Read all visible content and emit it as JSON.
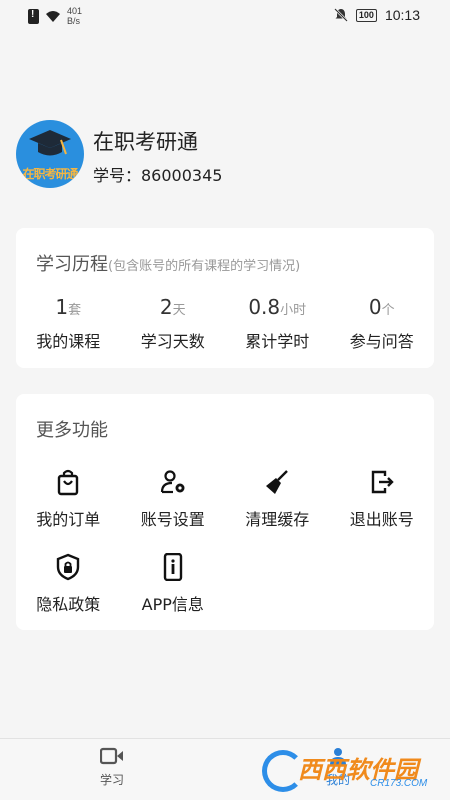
{
  "status_bar": {
    "net_speed_value": "401",
    "net_speed_unit": "B/s",
    "battery": "100",
    "time": "10:13"
  },
  "profile": {
    "avatar_text": "在职考研通",
    "app_name": "在职考研通",
    "student_id": "学号：86000345"
  },
  "history": {
    "title": "学习历程",
    "subtitle": "(包含账号的所有课程的学习情况)",
    "stats": [
      {
        "value": "1",
        "unit": "套",
        "label": "我的课程"
      },
      {
        "value": "2",
        "unit": "天",
        "label": "学习天数"
      },
      {
        "value": "0.8",
        "unit": "小时",
        "label": "累计学时"
      },
      {
        "value": "0",
        "unit": "个",
        "label": "参与问答"
      }
    ]
  },
  "more": {
    "title": "更多功能",
    "items": [
      {
        "label": "我的订单",
        "icon": "shopping-bag-icon"
      },
      {
        "label": "账号设置",
        "icon": "user-settings-icon"
      },
      {
        "label": "清理缓存",
        "icon": "broom-icon"
      },
      {
        "label": "退出账号",
        "icon": "logout-icon"
      },
      {
        "label": "隐私政策",
        "icon": "shield-lock-icon"
      },
      {
        "label": "APP信息",
        "icon": "phone-info-icon"
      }
    ]
  },
  "nav": {
    "study_label": "学习",
    "mine_label": "我的"
  },
  "watermark": {
    "brand": "西西软件园",
    "domain": "CR173.COM"
  },
  "colors": {
    "accent": "#2a7fd6",
    "background": "#f5f5f5",
    "card": "#ffffff"
  }
}
